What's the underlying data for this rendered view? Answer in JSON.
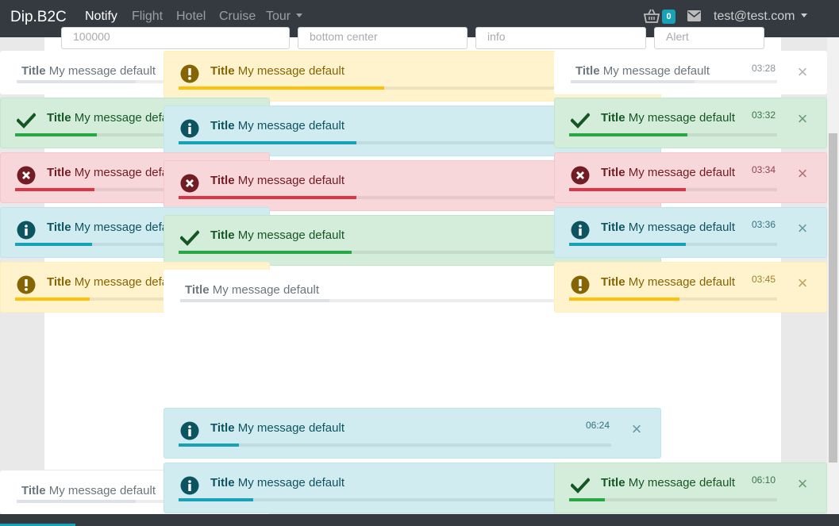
{
  "navbar": {
    "brand": "Dip.B2C",
    "links": [
      {
        "label": "Notify",
        "active": true
      },
      {
        "label": "Flight",
        "active": false
      },
      {
        "label": "Hotel",
        "active": false
      },
      {
        "label": "Cruise",
        "active": false
      },
      {
        "label": "Tour",
        "active": false
      }
    ],
    "cart_icon": "shopping-basket-icon",
    "cart_count": "0",
    "mail_icon": "envelope-icon",
    "user_email": "test@test.com"
  },
  "form": {
    "fields": [
      "100000",
      "bottom center",
      "info",
      "Alert"
    ]
  },
  "colors": {
    "navbar": "#343a40",
    "success": "#28a745",
    "danger": "#dc3545",
    "info": "#17a2b8",
    "warning": "#ffc107"
  },
  "toasts": [
    {
      "title": "Title",
      "message": "My message default",
      "type": "plain",
      "time": "",
      "progress": 0.5
    },
    {
      "title": "Title",
      "message": "My message default",
      "type": "warning",
      "time": "",
      "progress": 0.44,
      "icon": "exclamation-circle-icon"
    },
    {
      "title": "Title",
      "message": "My message default",
      "type": "plain",
      "time": "03:28",
      "progress": 0.6,
      "closable": true
    },
    {
      "title": "Title",
      "message": "My message default",
      "type": "success",
      "time": "",
      "progress": 0.34,
      "icon": "checkmark-icon"
    },
    {
      "title": "Title",
      "message": "My message default",
      "type": "info",
      "time": "",
      "progress": 0.38,
      "icon": "info-circle-icon"
    },
    {
      "title": "Title",
      "message": "My message default",
      "type": "success",
      "time": "03:32",
      "progress": 0.57,
      "icon": "checkmark-icon",
      "closable": true
    },
    {
      "title": "Title",
      "message": "My message default",
      "type": "danger",
      "time": "",
      "progress": 0.33,
      "icon": "x-circle-icon"
    },
    {
      "title": "Title",
      "message": "My message default",
      "type": "danger",
      "time": "",
      "progress": 0.38,
      "icon": "x-circle-icon"
    },
    {
      "title": "Title",
      "message": "My message default",
      "type": "danger",
      "time": "03:34",
      "progress": 0.56,
      "icon": "x-circle-icon",
      "closable": true
    },
    {
      "title": "Title",
      "message": "My message default",
      "type": "info",
      "time": "",
      "progress": 0.32,
      "icon": "info-circle-icon"
    },
    {
      "title": "Title",
      "message": "My message default",
      "type": "success",
      "time": "",
      "progress": 0.37,
      "icon": "checkmark-icon"
    },
    {
      "title": "Title",
      "message": "My message default",
      "type": "info",
      "time": "03:36",
      "progress": 0.56,
      "icon": "info-circle-icon",
      "closable": true
    },
    {
      "title": "Title",
      "message": "My message default",
      "type": "warning",
      "time": "",
      "progress": 0.31,
      "icon": "exclamation-circle-icon"
    },
    {
      "title": "Title",
      "message": "My message default",
      "type": "plain",
      "time": "",
      "progress": 0.32
    },
    {
      "title": "Title",
      "message": "My message default",
      "type": "warning",
      "time": "03:45",
      "progress": 0.53,
      "icon": "exclamation-circle-icon",
      "closable": true
    },
    {
      "title": "Title",
      "message": "My message default",
      "type": "info",
      "time": "06:24",
      "progress": 0.14,
      "icon": "info-circle-icon",
      "closable": true
    },
    {
      "title": "Title",
      "message": "My message default",
      "type": "plain",
      "time": "",
      "progress": 0.5
    },
    {
      "title": "Title",
      "message": "My message default",
      "type": "info",
      "time": "",
      "progress": 0.16,
      "icon": "info-circle-icon"
    },
    {
      "title": "Title",
      "message": "My message default",
      "type": "success",
      "time": "06:10",
      "progress": 0.17,
      "icon": "checkmark-icon",
      "closable": true
    }
  ]
}
